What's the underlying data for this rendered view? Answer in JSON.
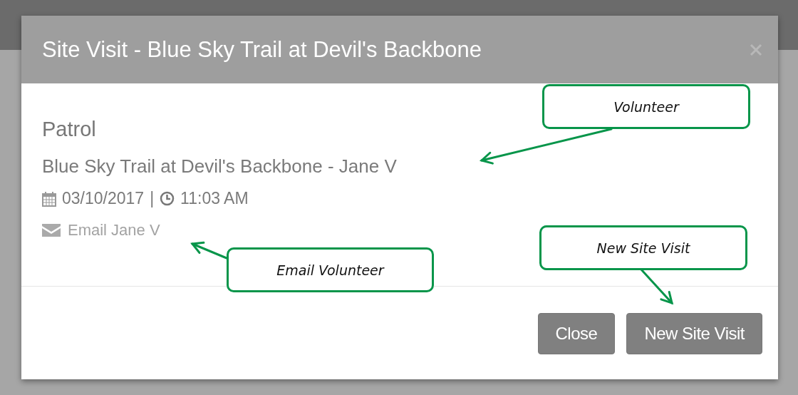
{
  "dialog": {
    "title": "Site Visit - Blue Sky Trail at Devil's Backbone",
    "heading": "Patrol",
    "subtitle": "Blue Sky Trail at Devil's Backbone - Jane V",
    "date": "03/10/2017",
    "separator": "|",
    "time": "11:03 AM",
    "email_link": "Email Jane V",
    "buttons": [
      {
        "label": "Close"
      },
      {
        "label": "New Site Visit"
      }
    ]
  },
  "callouts": [
    {
      "text": "Volunteer"
    },
    {
      "text": "Email Volunteer"
    },
    {
      "text": "New Site Visit"
    }
  ]
}
